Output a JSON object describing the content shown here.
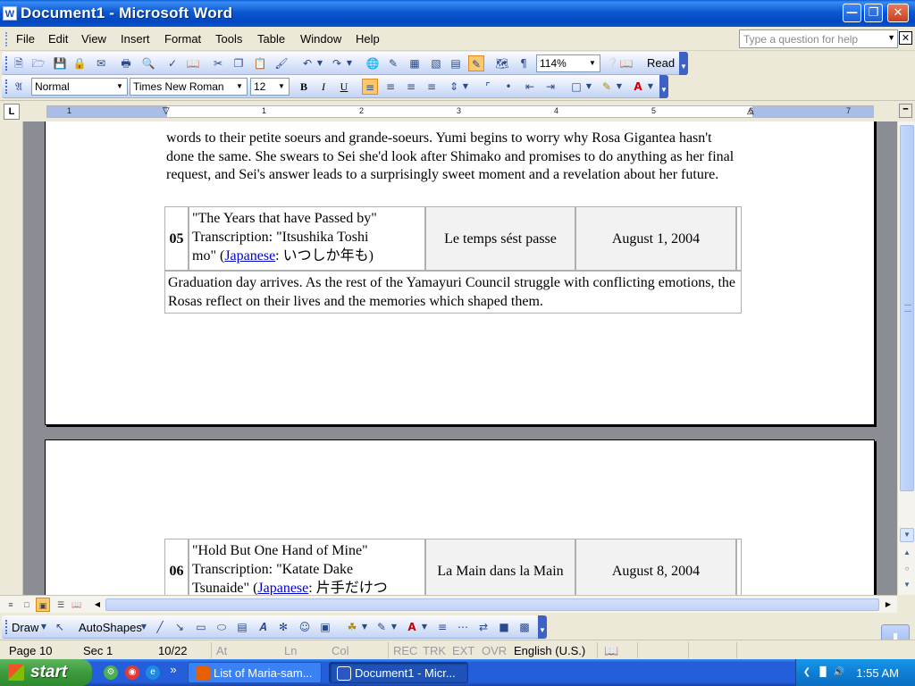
{
  "window": {
    "app_icon": "W",
    "title": "Document1 - Microsoft Word"
  },
  "menu": [
    "File",
    "Edit",
    "View",
    "Insert",
    "Format",
    "Tools",
    "Table",
    "Window",
    "Help"
  ],
  "help_box": {
    "placeholder": "Type a question for help"
  },
  "standard_toolbar": {
    "zoom": "114%",
    "read_label": "Read"
  },
  "formatting_toolbar": {
    "style": "Normal",
    "font": "Times New Roman",
    "size": "12"
  },
  "ruler": {
    "tab_selector": "L",
    "numbers": [
      "1",
      "1",
      "2",
      "3",
      "4",
      "5",
      "6",
      "7"
    ]
  },
  "document": {
    "summary_04_tail": "words to their petite soeurs and grande-soeurs. Yumi begins to worry why Rosa Gigantea hasn't done the same. She swears to Sei she'd look after Shimako and promises to do anything as her final request, and Sei's answer leads to a surprisingly sweet moment and a revelation about her future.",
    "episodes": [
      {
        "num": "05",
        "title_line1": "\"The Years that have Passed by\"",
        "title_line2": "Transcription: \"Itsushika Toshi",
        "title_line3": "mo\" (",
        "link": "Japanese",
        "japanese": ": いつしか年も)",
        "french": "Le temps sést passe",
        "date": "August 1, 2004",
        "summary": "Graduation day arrives. As the rest of the Yamayuri Council struggle with conflicting emotions, the Rosas reflect on their lives and the memories which shaped them."
      },
      {
        "num": "06",
        "title_line1": "\"Hold But One Hand of Mine\"",
        "title_line2": "Transcription: \"Katate Dake",
        "title_line3": "Tsunaide\" (",
        "link": "Japanese",
        "japanese": ": 片手だけつ",
        "french": "La Main dans la Main",
        "date": "August 8, 2004"
      }
    ]
  },
  "drawing_toolbar": {
    "draw_label": "Draw",
    "autoshapes_label": "AutoShapes"
  },
  "status": {
    "page": "Page 10",
    "section": "Sec 1",
    "pages": "10/22",
    "at": "At",
    "ln": "Ln",
    "col": "Col",
    "rec": "REC",
    "trk": "TRK",
    "ext": "EXT",
    "ovr": "OVR",
    "language": "English (U.S.)"
  },
  "taskbar": {
    "start_label": "start",
    "chevron": "»",
    "tasks": [
      "List of Maria-sam...",
      "Document1 - Micr..."
    ],
    "clock": "1:55 AM"
  }
}
